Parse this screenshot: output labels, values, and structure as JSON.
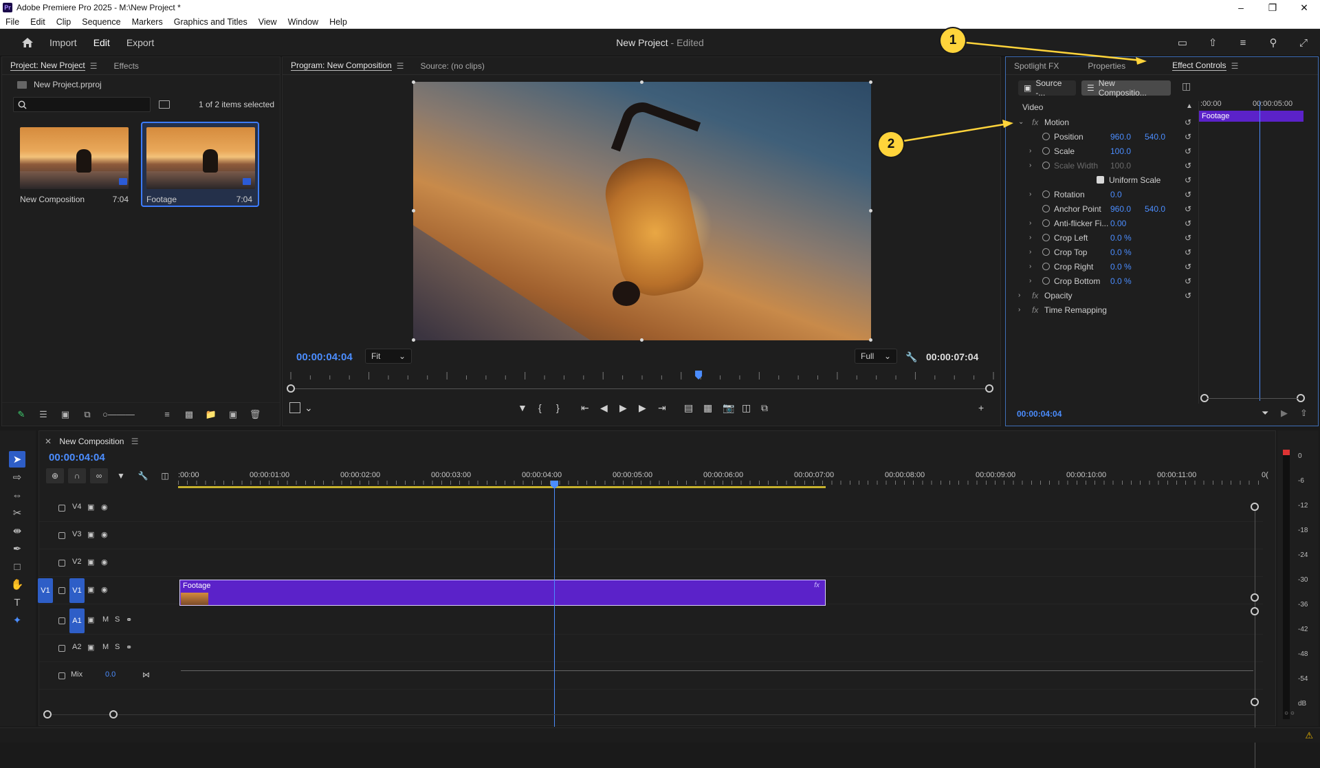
{
  "window": {
    "title": "Adobe Premiere Pro 2025 - M:\\New Project *",
    "logo": "Pr",
    "controls": [
      "minimize",
      "restore",
      "close"
    ]
  },
  "menu": [
    "File",
    "Edit",
    "Clip",
    "Sequence",
    "Markers",
    "Graphics and Titles",
    "View",
    "Window",
    "Help"
  ],
  "header": {
    "tabs": [
      "Import",
      "Edit",
      "Export"
    ],
    "active_tab": "Edit",
    "project_title": "New Project",
    "edited_suffix": " - Edited"
  },
  "project_panel": {
    "tabs": [
      "Project: New Project",
      "Effects"
    ],
    "file": "New Project.prproj",
    "selection": "1 of 2 items selected",
    "items": [
      {
        "name": "New Composition",
        "duration": "7:04"
      },
      {
        "name": "Footage",
        "duration": "7:04"
      }
    ]
  },
  "program_monitor": {
    "tabs": [
      "Program: New Composition",
      "Source: (no clips)"
    ],
    "current_time": "00:00:04:04",
    "fit": "Fit",
    "quality": "Full",
    "duration": "00:00:07:04",
    "playhead_fraction": 0.58
  },
  "effect_controls": {
    "tabs": [
      "Spotlight FX",
      "Properties",
      "Effect Controls"
    ],
    "source_chip": "Source -...",
    "comp_chip": "New Compositio...",
    "section": "Video",
    "mini_timeline": {
      "start": ":00:00",
      "mark": "00:00:05:00",
      "clip": "Footage"
    },
    "current_time": "00:00:04:04",
    "properties": [
      {
        "label": "Motion",
        "kind": "fx",
        "expanded": true
      },
      {
        "label": "Position",
        "v1": "960.0",
        "v2": "540.0"
      },
      {
        "label": "Scale",
        "v1": "100.0",
        "expand": true
      },
      {
        "label": "Scale Width",
        "v1": "100.0",
        "expand": true,
        "dim": true
      },
      {
        "label": "Uniform Scale",
        "checkbox": true
      },
      {
        "label": "Rotation",
        "v1": "0.0",
        "expand": true
      },
      {
        "label": "Anchor Point",
        "v1": "960.0",
        "v2": "540.0"
      },
      {
        "label": "Anti-flicker Fi...",
        "v1": "0.00",
        "expand": true
      },
      {
        "label": "Crop Left",
        "v1": "0.0 %",
        "expand": true
      },
      {
        "label": "Crop Top",
        "v1": "0.0 %",
        "expand": true
      },
      {
        "label": "Crop Right",
        "v1": "0.0 %",
        "expand": true
      },
      {
        "label": "Crop Bottom",
        "v1": "0.0 %",
        "expand": true
      },
      {
        "label": "Opacity",
        "kind": "fx"
      },
      {
        "label": "Time Remapping",
        "kind": "fx",
        "no_reset": true
      }
    ]
  },
  "timeline": {
    "sequence": "New Composition",
    "current_time": "00:00:04:04",
    "ruler": [
      ":00:00",
      "00:00:01:00",
      "00:00:02:00",
      "00:00:03:00",
      "00:00:04:00",
      "00:00:05:00",
      "00:00:06:00",
      "00:00:07:00",
      "00:00:08:00",
      "00:00:09:00",
      "00:00:10:00",
      "00:00:11:00",
      "0("
    ],
    "video_tracks": [
      "V4",
      "V3",
      "V2",
      "V1"
    ],
    "audio_tracks": [
      "A1",
      "A2"
    ],
    "source_patch_video": "V1",
    "mix_label": "Mix",
    "mix_value": "0.0",
    "track_buttons": {
      "mute": "M",
      "solo": "S"
    },
    "clip": {
      "name": "Footage",
      "track": "V1",
      "fx": "fx"
    }
  },
  "audio_meter": {
    "labels": [
      "0",
      "-6",
      "-12",
      "-18",
      "-24",
      "-30",
      "-36",
      "-42",
      "-48",
      "-54",
      "dB"
    ],
    "footer": "○ ○"
  },
  "callouts": [
    "1",
    "2"
  ],
  "colors": {
    "accent_blue": "#4b8dff",
    "clip_purple": "#5b22c9",
    "callout_yellow": "#ffd43b",
    "work_area": "#c7b22d"
  }
}
